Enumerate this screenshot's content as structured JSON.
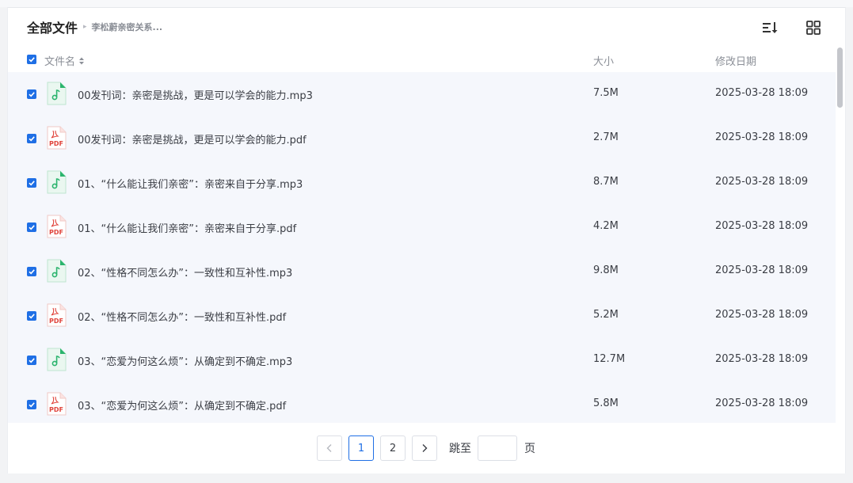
{
  "breadcrumb": {
    "root": "全部文件",
    "separator": "▸",
    "current": "李松蔚亲密关系..."
  },
  "toolbar": {
    "sort_icon": "sort-icon",
    "grid_icon": "grid-view-icon"
  },
  "columns": {
    "name": "文件名",
    "size": "大小",
    "date": "修改日期"
  },
  "files": [
    {
      "name": "00发刊词：亲密是挑战，更是可以学会的能力.mp3",
      "type": "mp3",
      "size": "7.5M",
      "date": "2025-03-28 18:09"
    },
    {
      "name": "00发刊词：亲密是挑战，更是可以学会的能力.pdf",
      "type": "pdf",
      "size": "2.7M",
      "date": "2025-03-28 18:09"
    },
    {
      "name": "01、“什么能让我们亲密”：亲密来自于分享.mp3",
      "type": "mp3",
      "size": "8.7M",
      "date": "2025-03-28 18:09"
    },
    {
      "name": "01、“什么能让我们亲密”：亲密来自于分享.pdf",
      "type": "pdf",
      "size": "4.2M",
      "date": "2025-03-28 18:09"
    },
    {
      "name": "02、“性格不同怎么办”：一致性和互补性.mp3",
      "type": "mp3",
      "size": "9.8M",
      "date": "2025-03-28 18:09"
    },
    {
      "name": "02、“性格不同怎么办”：一致性和互补性.pdf",
      "type": "pdf",
      "size": "5.2M",
      "date": "2025-03-28 18:09"
    },
    {
      "name": "03、“恋爱为何这么烦”：从确定到不确定.mp3",
      "type": "mp3",
      "size": "12.7M",
      "date": "2025-03-28 18:09"
    },
    {
      "name": "03、“恋爱为何这么烦”：从确定到不确定.pdf",
      "type": "pdf",
      "size": "5.8M",
      "date": "2025-03-28 18:09"
    }
  ],
  "pdf_label": "PDF",
  "pagination": {
    "pages": [
      "1",
      "2"
    ],
    "current": "1",
    "jump_label": "跳至",
    "jump_value": "",
    "unit": "页"
  },
  "colors": {
    "accent": "#1f6fe5",
    "mp3_icon": "#2bb46d",
    "pdf_icon": "#e0433b",
    "row_bg": "#f5f7fc"
  }
}
